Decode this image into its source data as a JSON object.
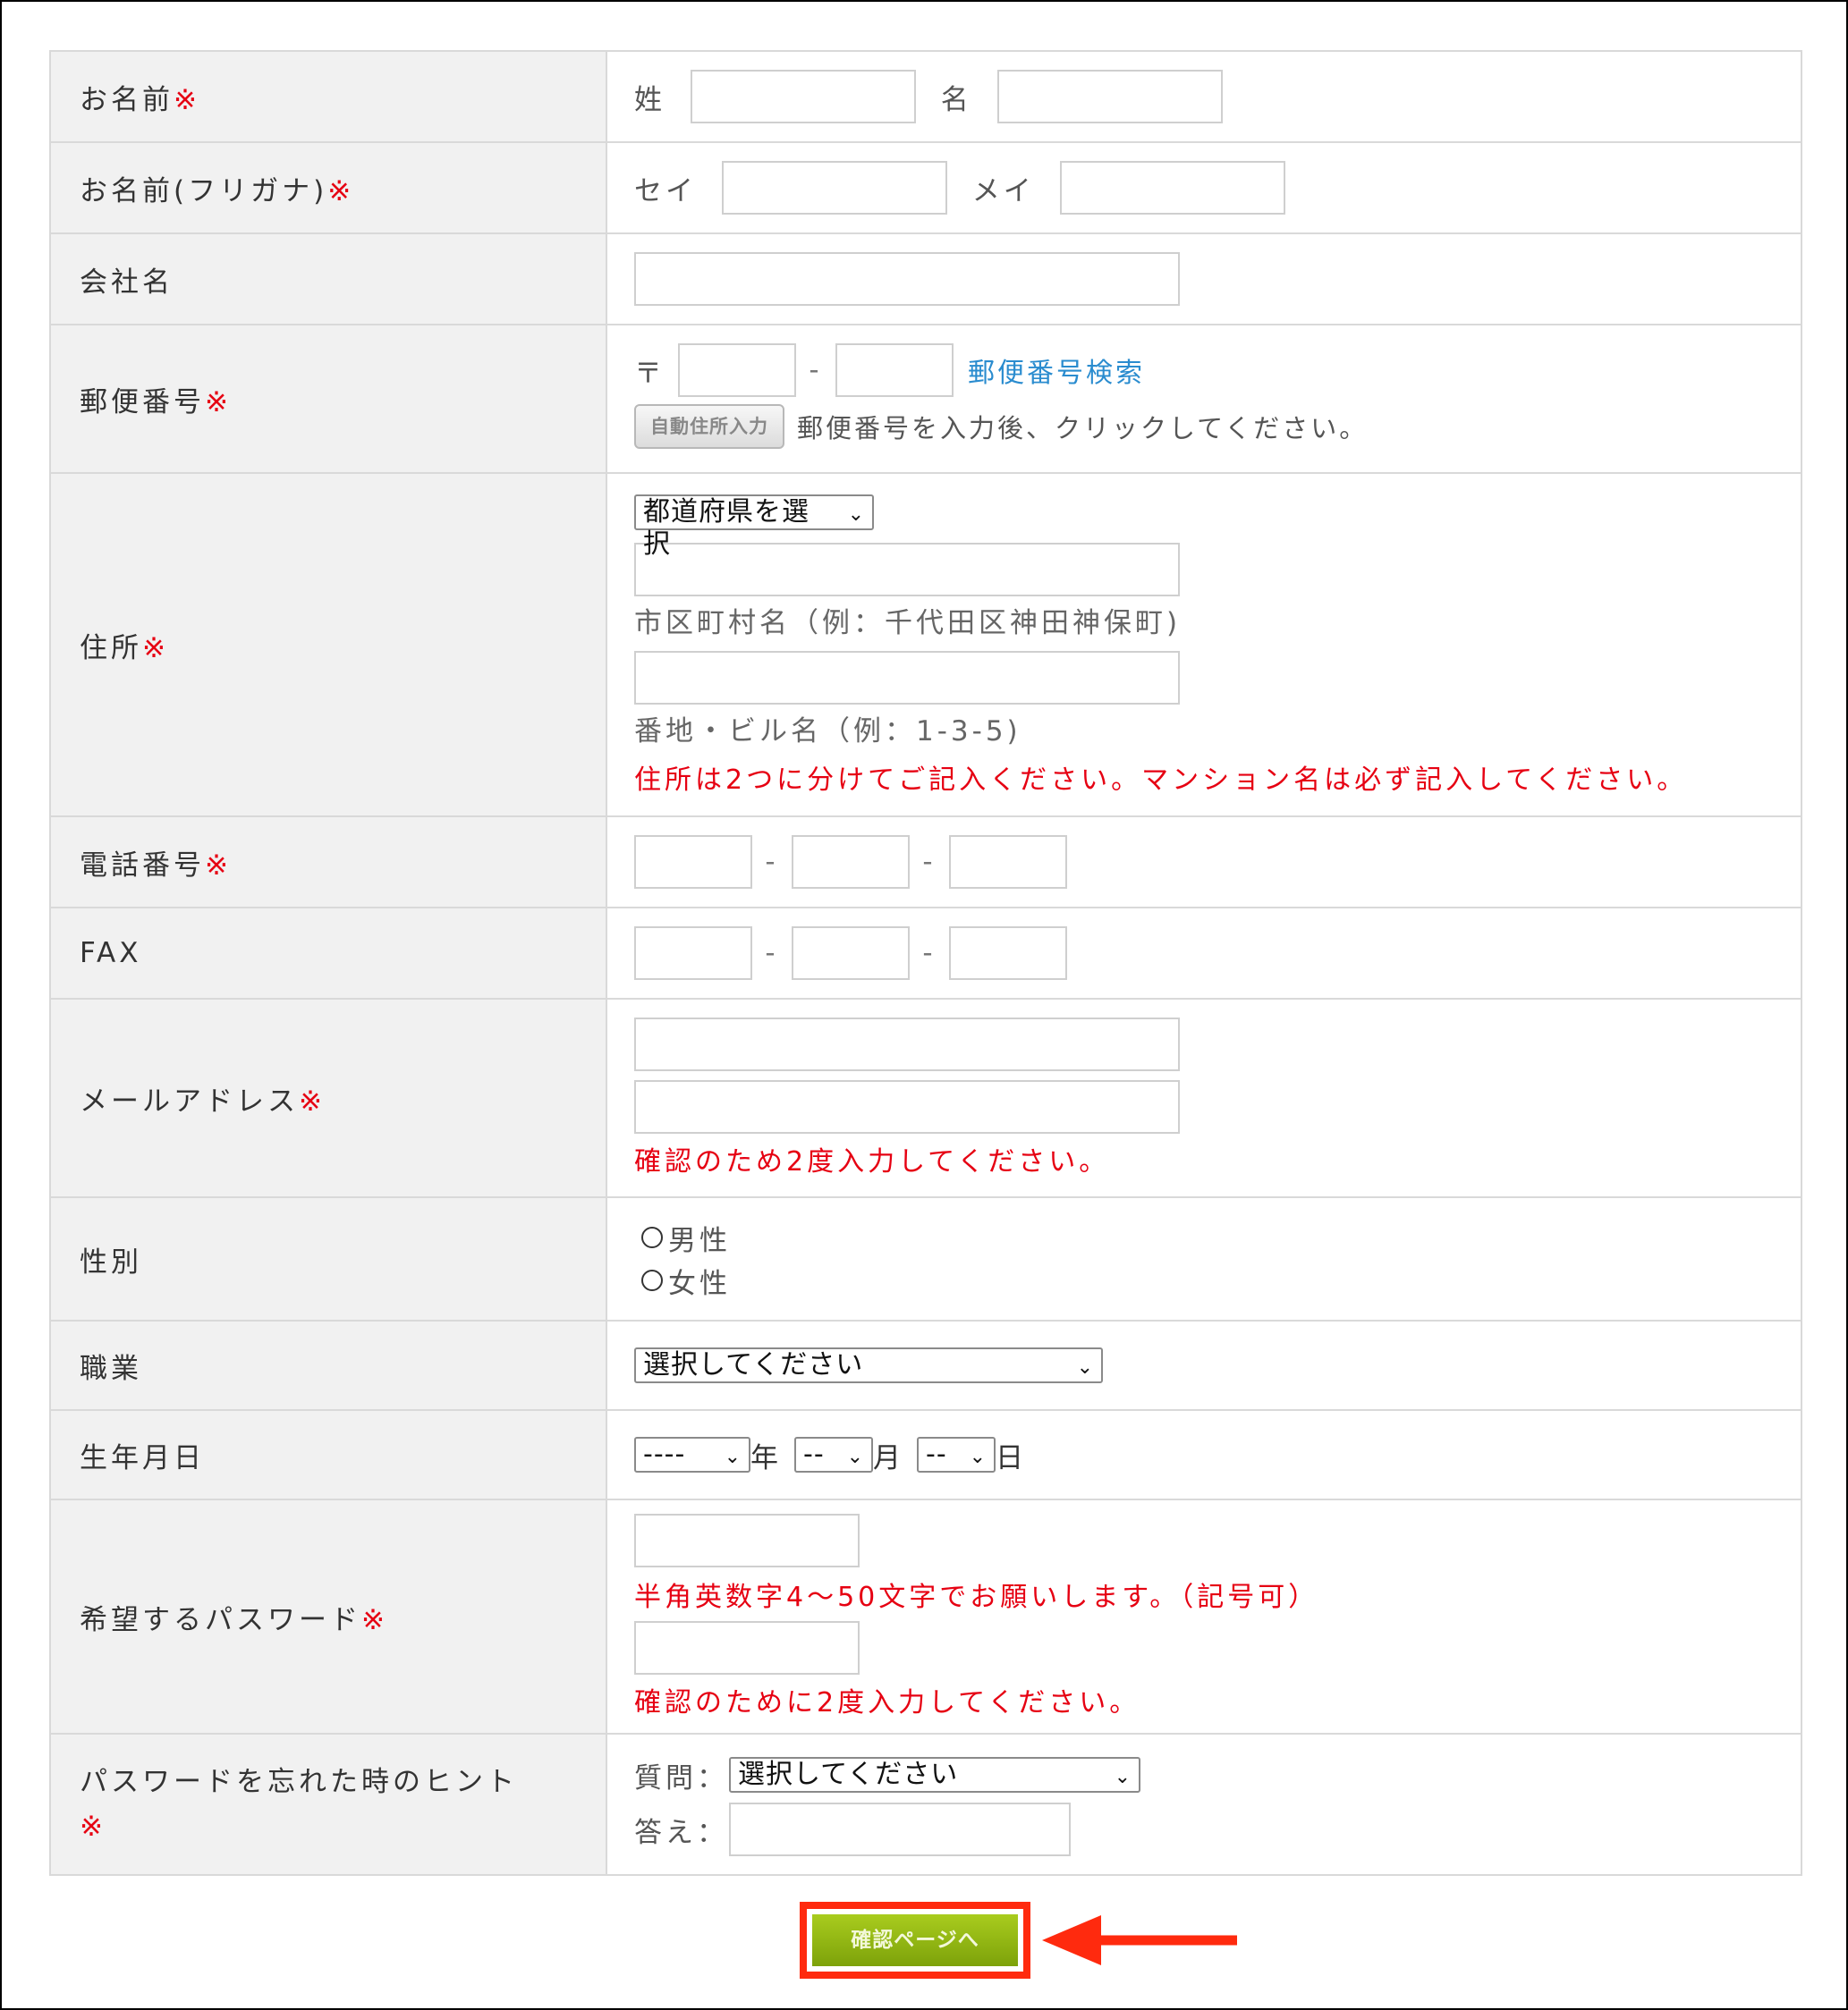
{
  "required_mark": "※",
  "rows": {
    "name": {
      "label": "お名前",
      "sei": "姓",
      "mei": "名"
    },
    "furigana": {
      "label": "お名前(フリガナ)",
      "sei": "セイ",
      "mei": "メイ"
    },
    "company": {
      "label": "会社名"
    },
    "postal": {
      "label": "郵便番号",
      "mark": "〒",
      "dash": "-",
      "search_link": "郵便番号検索",
      "auto_button": "自動住所入力",
      "auto_hint": "郵便番号を入力後、クリックしてください。"
    },
    "address": {
      "label": "住所",
      "prefecture_select": "都道府県を選択",
      "city_hint": "市区町村名（例：千代田区神田神保町)",
      "street_hint": "番地・ビル名（例：1-3-5)",
      "note": "住所は2つに分けてご記入ください。マンション名は必ず記入してください。"
    },
    "phone": {
      "label": "電話番号",
      "dash": "-"
    },
    "fax": {
      "label": "FAX",
      "dash": "-"
    },
    "email": {
      "label": "メールアドレス",
      "note": "確認のため2度入力してください。"
    },
    "gender": {
      "label": "性別",
      "options": [
        "男性",
        "女性"
      ]
    },
    "job": {
      "label": "職業",
      "select": "選択してください"
    },
    "birthday": {
      "label": "生年月日",
      "year_select": "----",
      "year_unit": "年",
      "month_select": "--",
      "month_unit": "月",
      "day_select": "--",
      "day_unit": "日"
    },
    "password": {
      "label": "希望するパスワード",
      "note1": "半角英数字4～50文字でお願いします。（記号可）",
      "note2": "確認のために2度入力してください。"
    },
    "hint": {
      "label": "パスワードを忘れた時のヒント",
      "question_label": "質問：",
      "question_select": "選択してください",
      "answer_label": "答え："
    }
  },
  "submit_button": "確認ページへ",
  "colors": {
    "required": "#e60012",
    "link": "#2a8ccf",
    "label_bg": "#f1f1f1",
    "highlight": "#ff2a0e",
    "button": "#8fb512"
  }
}
